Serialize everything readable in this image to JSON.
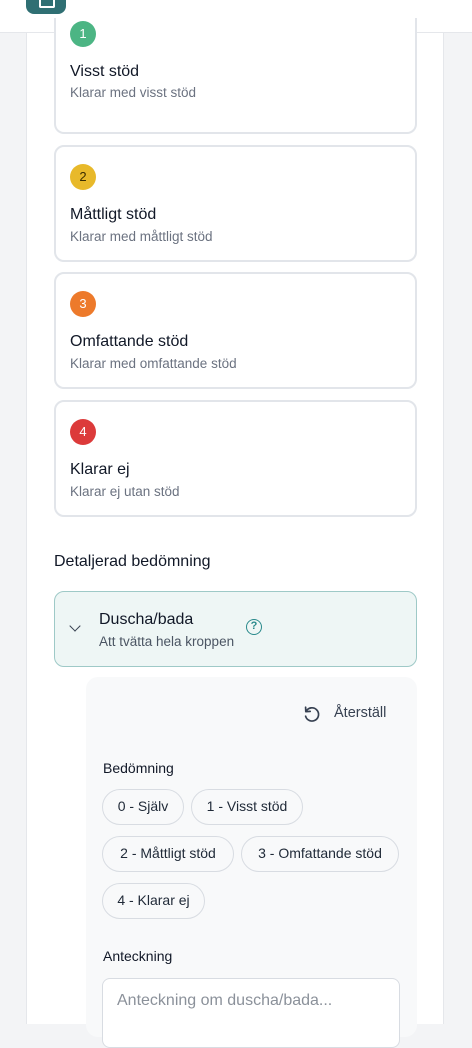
{
  "levels": [
    {
      "number": "1",
      "title": "Visst stöd",
      "desc": "Klarar med visst stöd",
      "color": "#4cb584"
    },
    {
      "number": "2",
      "title": "Måttligt stöd",
      "desc": "Klarar med måttligt stöd",
      "color": "#e8b92a"
    },
    {
      "number": "3",
      "title": "Omfattande stöd",
      "desc": "Klarar med omfattande stöd",
      "color": "#ed7a2b"
    },
    {
      "number": "4",
      "title": "Klarar ej",
      "desc": "Klarar ej utan stöd",
      "color": "#dc3a3a"
    }
  ],
  "detail": {
    "heading": "Detaljerad bedömning",
    "item": {
      "title": "Duscha/bada",
      "subtitle": "Att tvätta hela kroppen",
      "help_icon": "?"
    },
    "reset_label": "Återställ",
    "assessment_label": "Bedömning",
    "options": [
      {
        "label": "0 - Själv"
      },
      {
        "label": "1 - Visst stöd"
      },
      {
        "label": "2 - Måttligt stöd"
      },
      {
        "label": "3 - Omfattande stöd"
      },
      {
        "label": "4 - Klarar ej"
      }
    ],
    "note_label": "Anteckning",
    "note_placeholder": "Anteckning om duscha/bada..."
  }
}
